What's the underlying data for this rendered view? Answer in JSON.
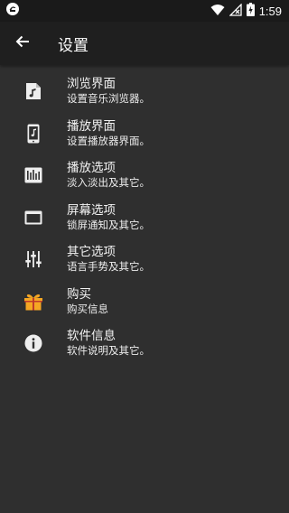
{
  "status_bar": {
    "time": "1:59"
  },
  "header": {
    "title": "设置"
  },
  "items": [
    {
      "title": "浏览界面",
      "subtitle": "设置音乐浏览器。",
      "icon": "music-file-icon"
    },
    {
      "title": "播放界面",
      "subtitle": "设置播放器界面。",
      "icon": "phone-music-icon"
    },
    {
      "title": "播放选项",
      "subtitle": "淡入淡出及其它。",
      "icon": "equalizer-icon"
    },
    {
      "title": "屏幕选项",
      "subtitle": "锁屏通知及其它。",
      "icon": "screen-icon"
    },
    {
      "title": "其它选项",
      "subtitle": "语言手势及其它。",
      "icon": "tune-icon"
    },
    {
      "title": "购买",
      "subtitle": "购买信息",
      "icon": "gift-icon"
    },
    {
      "title": "软件信息",
      "subtitle": "软件说明及其它。",
      "icon": "info-icon"
    }
  ],
  "colors": {
    "background": "#2f2f2f",
    "appbar": "#1f1f1f",
    "statusbar": "#1a1a1a",
    "gift": "#f5a623"
  }
}
